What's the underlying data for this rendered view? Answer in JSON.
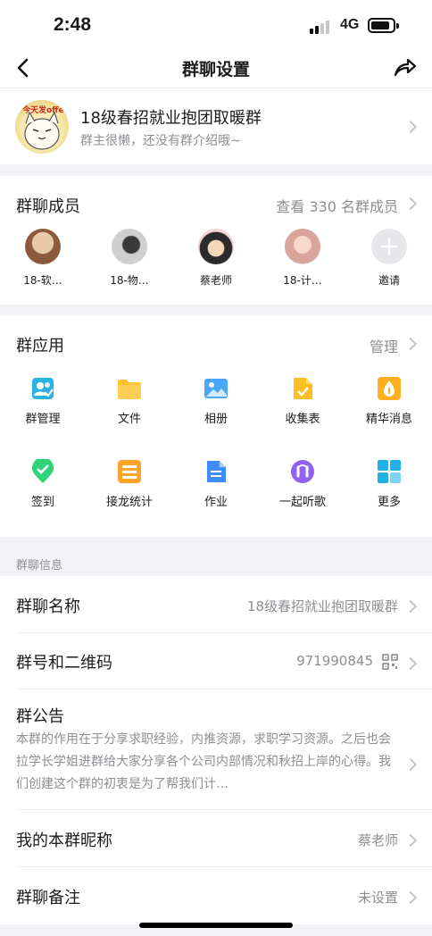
{
  "status_bar": {
    "time": "2:48",
    "network": "4G",
    "battery_level_percent": 85
  },
  "nav": {
    "title": "群聊设置",
    "back_icon": "chevron-left-icon",
    "share_icon": "share-arrow-icon"
  },
  "group": {
    "name": "18级春招就业抱团取暖群",
    "intro": "群主很懒，还没有群介绍哦~",
    "avatar_text": "今天发offer"
  },
  "members": {
    "title": "群聊成员",
    "view_all": "查看 330 名群成员",
    "list": [
      {
        "name": "18-软…",
        "color": "#8b5a3c"
      },
      {
        "name": "18-物…",
        "color": "#9e9e9e"
      },
      {
        "name": "蔡老师",
        "color": "#d8b07a"
      },
      {
        "name": "18-计…",
        "color": "#d9a49a"
      }
    ],
    "invite_label": "邀请"
  },
  "apps": {
    "title": "群应用",
    "manage": "管理",
    "items": [
      {
        "label": "群管理",
        "icon": "group-manage-icon",
        "color": "#2bb3e6"
      },
      {
        "label": "文件",
        "icon": "folder-icon",
        "color": "#ffc233"
      },
      {
        "label": "相册",
        "icon": "album-icon",
        "color": "#4aa7f5"
      },
      {
        "label": "收集表",
        "icon": "collection-form-icon",
        "color": "#ffbf24"
      },
      {
        "label": "精华消息",
        "icon": "essence-message-icon",
        "color": "#ffb020"
      },
      {
        "label": "签到",
        "icon": "check-in-icon",
        "color": "#2ed47a"
      },
      {
        "label": "接龙统计",
        "icon": "relay-stats-icon",
        "color": "#ffa426"
      },
      {
        "label": "作业",
        "icon": "homework-icon",
        "color": "#3f8cff"
      },
      {
        "label": "一起听歌",
        "icon": "listen-together-icon",
        "color": "#8f63f0"
      },
      {
        "label": "更多",
        "icon": "more-apps-icon",
        "color": "#1fb0e8"
      }
    ]
  },
  "info": {
    "header": "群聊信息",
    "name_label": "群聊名称",
    "name_value": "18级春招就业抱团取暖群",
    "number_label": "群号和二维码",
    "number_value": "971990845",
    "notice_label": "群公告",
    "notice_text": "本群的作用在于分享求职经验，内推资源，求职学习资源。之后也会拉学长学姐进群给大家分享各个公司内部情况和秋招上岸的心得。我们创建这个群的初衷是为了帮我们计…",
    "nickname_label": "我的本群昵称",
    "nickname_value": "蔡老师",
    "remark_label": "群聊备注",
    "remark_value": "未设置"
  }
}
